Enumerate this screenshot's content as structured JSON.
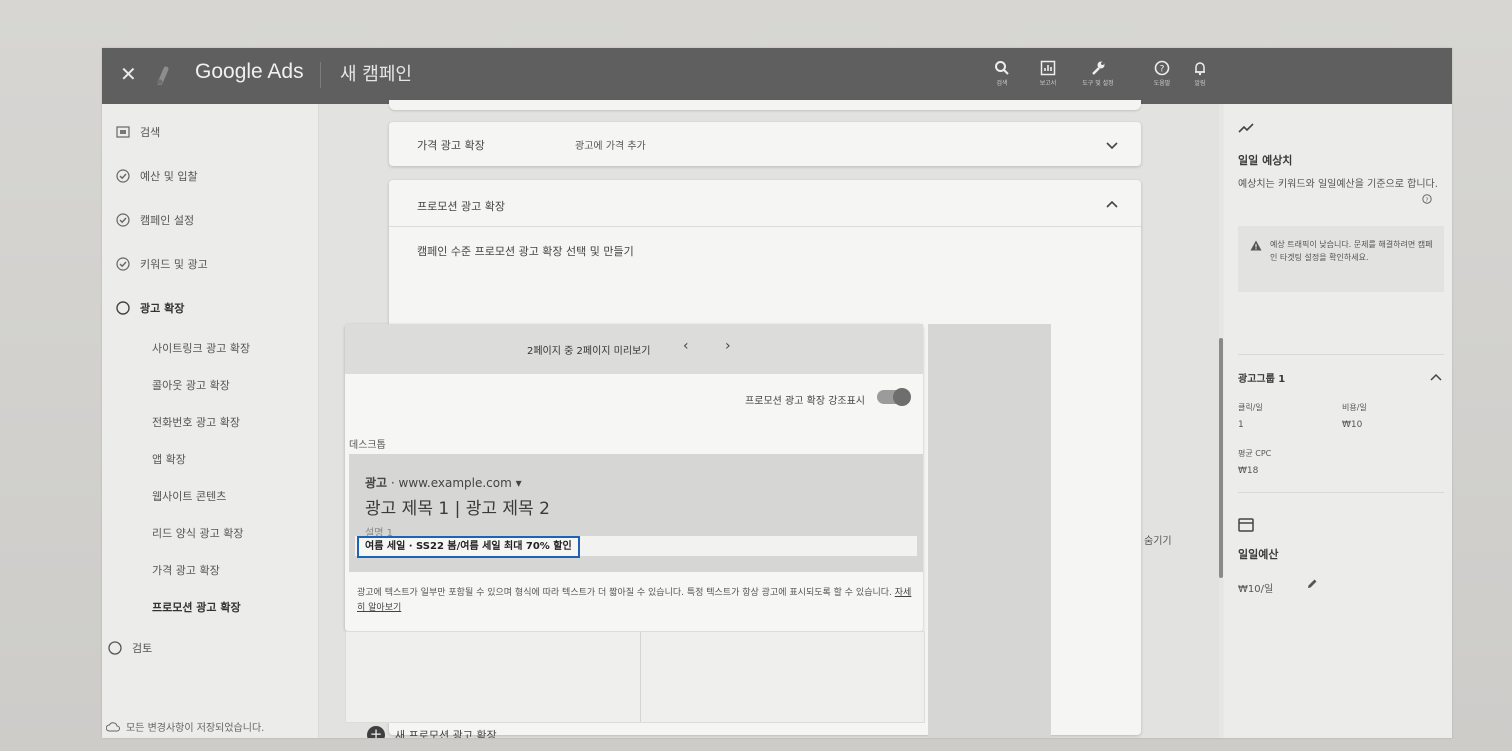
{
  "topbar": {
    "close_icon": "close-icon",
    "brand": "Google Ads",
    "campaign": "새 캠페인",
    "tools": [
      {
        "icon": "search-icon",
        "label": "검색"
      },
      {
        "icon": "report-icon",
        "label": "보고서"
      },
      {
        "icon": "wrench-icon",
        "label": "도구 및 설정"
      },
      {
        "icon": "help-icon",
        "label": "도움말"
      },
      {
        "icon": "bell-icon",
        "label": "알림"
      }
    ]
  },
  "sidebar": {
    "items": [
      {
        "label": "검색",
        "icon": "browser-icon",
        "state": "done"
      },
      {
        "label": "예산 및 입찰",
        "icon": "check-circle-icon",
        "state": "done"
      },
      {
        "label": "캠페인 설정",
        "icon": "check-circle-icon",
        "state": "done"
      },
      {
        "label": "키워드 및 광고",
        "icon": "check-circle-icon",
        "state": "done"
      },
      {
        "label": "광고 확장",
        "icon": "circle-icon",
        "state": "current"
      }
    ],
    "sub_items": [
      "사이트링크 광고 확장",
      "콜아웃 광고 확장",
      "전화번호 광고 확장",
      "앱 확장",
      "웹사이트 콘텐츠",
      "리드 양식 광고 확장",
      "가격 광고 확장",
      "프로모션 광고 확장"
    ],
    "review": "검토",
    "saved": "모든 변경사항이 저장되었습니다."
  },
  "main": {
    "price_ext": {
      "title": "가격 광고 확장",
      "subtitle": "광고에 가격 추가"
    },
    "promo_ext": {
      "title": "프로모션 광고 확장",
      "subtitle": "캠페인 수준 프로모션 광고 확장 선택 및 만들기",
      "preview": {
        "page_label": "2페이지 중 2페이지 미리보기",
        "toggle_label": "프로모션 광고 확장 강조표시",
        "toggle_on": true,
        "device_label": "데스크톱",
        "ad_label": "광고",
        "ad_url": "· www.example.com ▾",
        "ad_title": "광고 제목 1 | 광고 제목 2",
        "ad_desc": "설명 1",
        "promo_text": "여름 세일 · SS22 봄/여름 세일 최대 70% 할인",
        "disclaimer": "광고에 텍스트가 일부만 포함될 수 있으며 형식에 따라 텍스트가 더 짧아질 수 있습니다. 특정 텍스트가 항상 광고에 표시되도록 할 수 있습니다.",
        "learn_more": "자세히 알아보기"
      },
      "hide_label": "숨기기",
      "new_button": "새 프로모션 광고 확장"
    }
  },
  "rightpanel": {
    "title": "일일 예상치",
    "desc": "예상치는 키워드와 일일예산을 기준으로 합니다.",
    "warning": "예상 트래픽이 낮습니다. 문제를 해결하려면 캠페인 타겟팅 설정을 확인하세요.",
    "adgroup": {
      "title": "광고그룹 1",
      "clicks_label": "클릭/일",
      "clicks_value": "1",
      "cost_label": "비용/일",
      "cost_value": "₩10",
      "cpc_label": "평균 CPC",
      "cpc_value": "₩18"
    },
    "budget": {
      "title": "일일예산",
      "value": "₩10/일"
    }
  }
}
